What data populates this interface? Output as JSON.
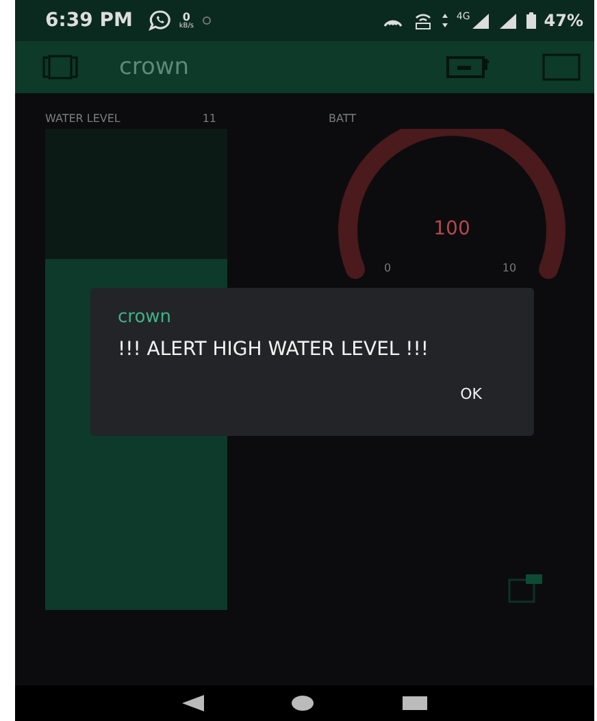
{
  "status_bar": {
    "time": "6:39 PM",
    "net_speed": "0",
    "net_unit": "kB/s",
    "network": "4G",
    "battery": "47%"
  },
  "app_bar": {
    "title": "crown"
  },
  "widgets": [
    {
      "kind": "level",
      "label": "WATER LEVEL",
      "value": "11",
      "level": 0.73
    },
    {
      "kind": "gauge",
      "label": "BATT",
      "value": "100",
      "min": "0",
      "max": "10"
    }
  ],
  "dialog": {
    "title": "crown",
    "message": "!!! ALERT HIGH WATER LEVEL !!!",
    "buttons": [
      "OK"
    ]
  }
}
